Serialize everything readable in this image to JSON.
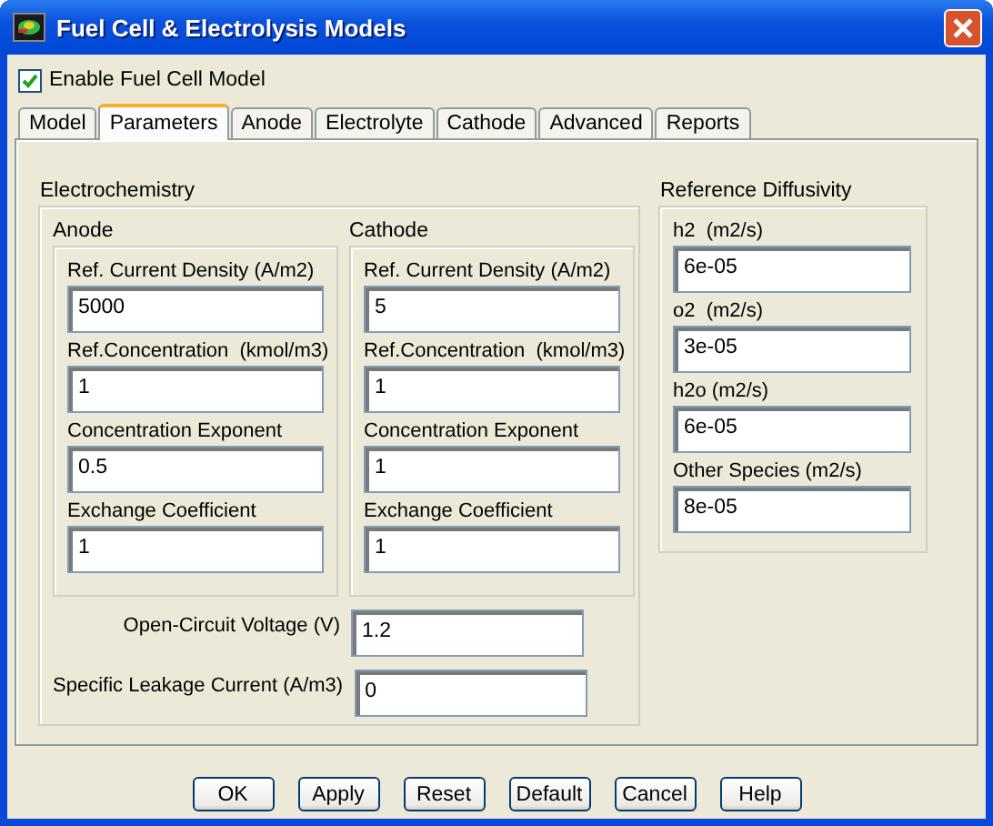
{
  "window": {
    "title": "Fuel Cell & Electrolysis Models"
  },
  "enable_fuel_cell_model": {
    "label": "Enable Fuel Cell Model",
    "checked": true
  },
  "tabs": [
    {
      "label": "Model",
      "selected": false
    },
    {
      "label": "Parameters",
      "selected": true
    },
    {
      "label": "Anode",
      "selected": false
    },
    {
      "label": "Electrolyte",
      "selected": false
    },
    {
      "label": "Cathode",
      "selected": false
    },
    {
      "label": "Advanced",
      "selected": false
    },
    {
      "label": "Reports",
      "selected": false
    }
  ],
  "electrochemistry": {
    "title": "Electrochemistry",
    "anode": {
      "title": "Anode",
      "fields": [
        {
          "label": "Ref. Current Density (A/m2)",
          "value": "5000"
        },
        {
          "label": "Ref.Concentration  (kmol/m3)",
          "value": "1"
        },
        {
          "label": "Concentration Exponent",
          "value": "0.5"
        },
        {
          "label": "Exchange Coefficient",
          "value": "1"
        }
      ]
    },
    "cathode": {
      "title": "Cathode",
      "fields": [
        {
          "label": "Ref. Current Density (A/m2)",
          "value": "5"
        },
        {
          "label": "Ref.Concentration  (kmol/m3)",
          "value": "1"
        },
        {
          "label": "Concentration Exponent",
          "value": "1"
        },
        {
          "label": "Exchange Coefficient",
          "value": "1"
        }
      ]
    },
    "open_circuit_voltage": {
      "label": "Open-Circuit Voltage (V)",
      "value": "1.2"
    },
    "specific_leakage_current": {
      "label": "Specific Leakage Current (A/m3)",
      "value": "0"
    }
  },
  "reference_diffusivity": {
    "title": "Reference Diffusivity",
    "fields": [
      {
        "label": "h2  (m2/s)",
        "value": "6e-05"
      },
      {
        "label": "o2  (m2/s)",
        "value": "3e-05"
      },
      {
        "label": "h2o (m2/s)",
        "value": "6e-05"
      },
      {
        "label": "Other Species (m2/s)",
        "value": "8e-05"
      }
    ]
  },
  "buttons": [
    "OK",
    "Apply",
    "Reset",
    "Default",
    "Cancel",
    "Help"
  ]
}
